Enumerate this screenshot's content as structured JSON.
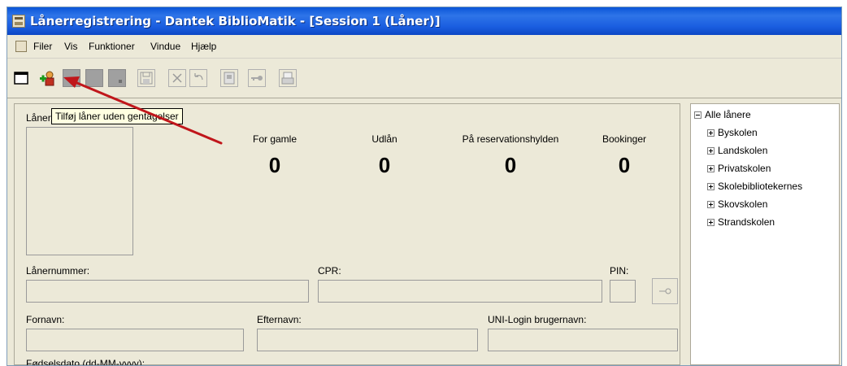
{
  "window": {
    "title": "Lånerregistrering - Dantek BiblioMatik - [Session 1 (Låner)]"
  },
  "menu": [
    {
      "label": "Filer"
    },
    {
      "label": "Vis"
    },
    {
      "label": "Funktioner"
    },
    {
      "label": "Vindue"
    },
    {
      "label": "Hjælp"
    }
  ],
  "toolbar": {
    "tooltip": "Tilføj låner uden gentagelser",
    "icons": [
      "new-window-icon",
      "add-borrower-icon",
      "disabled-icon",
      "disabled-icon",
      "disabled-icon",
      "save-icon",
      "delete-icon",
      "undo-icon",
      "properties-icon",
      "key-icon",
      "print-preview-icon"
    ]
  },
  "main": {
    "photo_label": "Låner",
    "counters": [
      {
        "label": "For gamle",
        "value": "0"
      },
      {
        "label": "Udlån",
        "value": "0"
      },
      {
        "label": "På reservationshylden",
        "value": "0"
      },
      {
        "label": "Bookinger",
        "value": "0"
      }
    ],
    "fields": {
      "borrower_number_label": "Lånernummer:",
      "cpr_label": "CPR:",
      "pin_label": "PIN:",
      "firstname_label": "Fornavn:",
      "lastname_label": "Efternavn:",
      "uni_login_label": "UNI-Login brugernavn:",
      "birthdate_label": "Fødselsdato (dd-MM-yyyy):"
    }
  },
  "tree": {
    "root": "Alle lånere",
    "children": [
      "Byskolen",
      "Landskolen",
      "Privatskolen",
      "Skolebibliotekernes",
      "Skovskolen",
      "Strandskolen"
    ]
  },
  "colors": {
    "title_bar": "#0a55d8",
    "annotation_arrow": "#c0161b",
    "tooltip_bg": "#ffffe1"
  }
}
